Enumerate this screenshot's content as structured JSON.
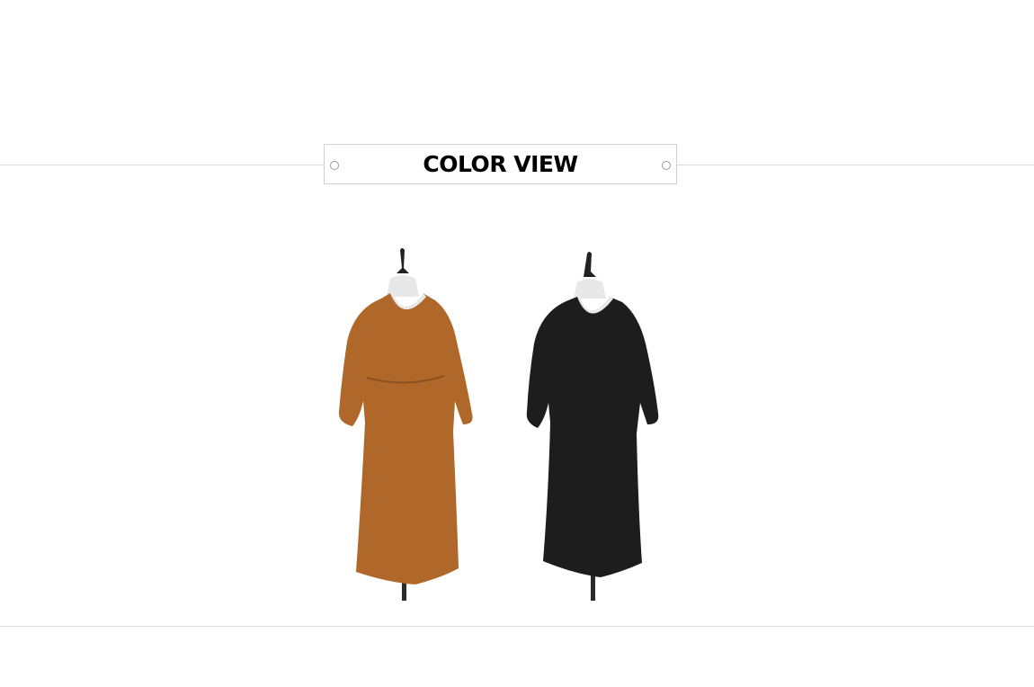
{
  "section": {
    "title": "COLOR VIEW"
  },
  "products": [
    {
      "name": "brown-dress",
      "color": "#b0672a",
      "shade": "#8e5020"
    },
    {
      "name": "black-dress",
      "color": "#1d1d1d",
      "shade": "#0c0c0c"
    }
  ]
}
